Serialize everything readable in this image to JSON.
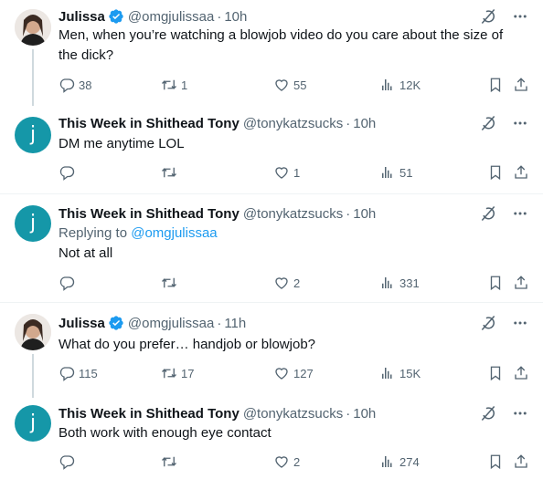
{
  "tweets": [
    {
      "name": "Julissa",
      "handle": "@omgjulissaa",
      "time": "10h",
      "text": "Men, when you’re watching a blowjob video do you care about the size of the dick?",
      "replies": "38",
      "retweets": "1",
      "likes": "55",
      "views": "12K"
    },
    {
      "avatar_letter": "j",
      "name": "This Week in Shithead Tony",
      "handle": "@tonykatzsucks",
      "time": "10h",
      "text": "DM me anytime LOL",
      "replies": "",
      "retweets": "",
      "likes": "1",
      "views": "51"
    },
    {
      "avatar_letter": "j",
      "name": "This Week in Shithead Tony",
      "handle": "@tonykatzsucks",
      "time": "10h",
      "replying_prefix": "Replying to",
      "replying_to": "@omgjulissaa",
      "text": "Not at all",
      "replies": "",
      "retweets": "",
      "likes": "2",
      "views": "331"
    },
    {
      "name": "Julissa",
      "handle": "@omgjulissaa",
      "time": "11h",
      "text": "What do you prefer… handjob or blowjob?",
      "replies": "115",
      "retweets": "17",
      "likes": "127",
      "views": "15K"
    },
    {
      "avatar_letter": "j",
      "name": "This Week in Shithead Tony",
      "handle": "@tonykatzsucks",
      "time": "10h",
      "text": "Both work with enough eye contact",
      "replies": "",
      "retweets": "",
      "likes": "2",
      "views": "274"
    }
  ],
  "separator": "·",
  "colors": {
    "verified": "#1d9bf0",
    "avatar_bg": "#1597a8",
    "icon": "#536471",
    "link": "#1d9bf0"
  },
  "icons": [
    "verified-badge-icon",
    "grok-icon",
    "more-icon",
    "reply-icon",
    "retweet-icon",
    "like-icon",
    "views-icon",
    "bookmark-icon",
    "share-icon"
  ]
}
